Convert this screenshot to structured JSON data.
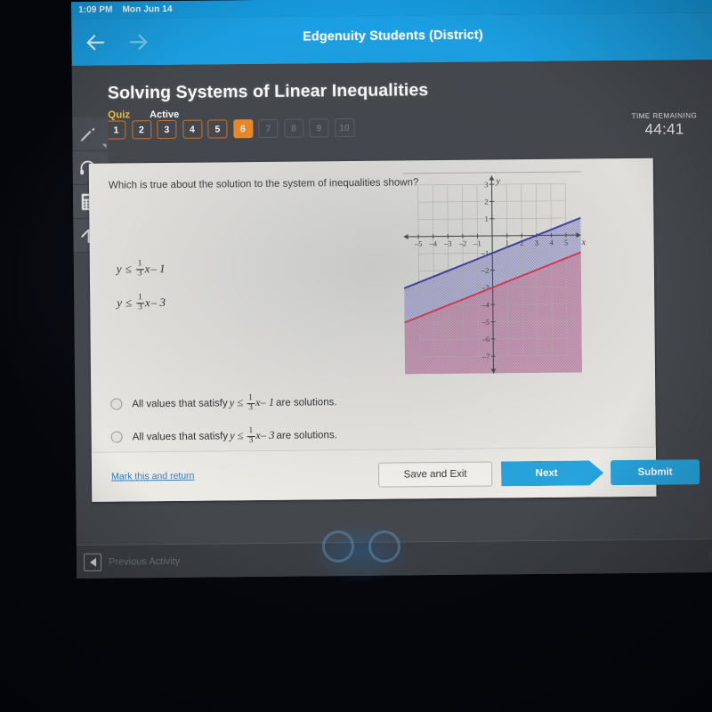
{
  "statusbar": {
    "time": "1:09 PM",
    "date": "Mon Jun 14"
  },
  "appbar": {
    "title": "Edgenuity Students (District)",
    "back_icon": "arrow-back-icon",
    "forward_icon": "arrow-forward-icon"
  },
  "lesson": {
    "title": "Solving Systems of Linear Inequalities",
    "type_label": "Quiz",
    "status_label": "Active"
  },
  "pager": {
    "items": [
      {
        "label": "1",
        "state": "done"
      },
      {
        "label": "2",
        "state": "done"
      },
      {
        "label": "3",
        "state": "done"
      },
      {
        "label": "4",
        "state": "done"
      },
      {
        "label": "5",
        "state": "done"
      },
      {
        "label": "6",
        "state": "current"
      },
      {
        "label": "7",
        "state": "locked"
      },
      {
        "label": "8",
        "state": "locked"
      },
      {
        "label": "9",
        "state": "locked"
      },
      {
        "label": "10",
        "state": "locked"
      }
    ]
  },
  "timer": {
    "label": "TIME REMAINING",
    "value": "44:41"
  },
  "toolrail": {
    "items": [
      {
        "name": "pencil-tool",
        "icon": "pencil-icon"
      },
      {
        "name": "audio-tool",
        "icon": "headphones-icon"
      },
      {
        "name": "calculator-tool",
        "icon": "calculator-icon"
      },
      {
        "name": "collapse-tool",
        "icon": "arrow-up-icon"
      }
    ]
  },
  "question": {
    "prompt": "Which is true about the solution to the system of inequalities shown?",
    "inequalities": [
      {
        "lhs": "y",
        "op": "≤",
        "num": "1",
        "den": "3",
        "var": "x",
        "tail": "– 1"
      },
      {
        "lhs": "y",
        "op": "≤",
        "num": "1",
        "den": "3",
        "var": "x",
        "tail": "– 3"
      }
    ],
    "options": [
      {
        "selected": false,
        "prefix": "All values that satisfy",
        "lhs": "y",
        "op": "≤",
        "num": "1",
        "den": "3",
        "var": "x",
        "tail": "– 1",
        "suffix": "are solutions."
      },
      {
        "selected": false,
        "prefix": "All values that satisfy",
        "lhs": "y",
        "op": "≤",
        "num": "1",
        "den": "3",
        "var": "x",
        "tail": "– 3",
        "suffix": "are solutions."
      }
    ]
  },
  "chart_data": {
    "type": "line",
    "title": "",
    "xlabel": "x",
    "ylabel": "y",
    "xlim": [
      -6,
      6
    ],
    "ylim": [
      -8,
      3.5
    ],
    "xticks": [
      -5,
      -4,
      -3,
      -2,
      -1,
      1,
      2,
      3,
      4,
      5
    ],
    "xticklabels": [
      "-5",
      "-4",
      "-3",
      "-2",
      "-1",
      "1",
      "2",
      "3",
      "4",
      "5"
    ],
    "yticks": [
      3,
      2,
      1,
      -1,
      -2,
      -3,
      -4,
      -5,
      -6,
      -7
    ],
    "yticklabels": [
      "3",
      "2",
      "1",
      "-1",
      "-2",
      "-3",
      "-4",
      "-5",
      "-6",
      "-7"
    ],
    "grid": true,
    "legend": "none",
    "series": [
      {
        "name": "y = (1/3)x - 1",
        "type": "line",
        "slope": 0.3333,
        "intercept": -1,
        "color": "#3f3fa8",
        "linestyle": "solid",
        "shade": "below",
        "shade_color": "#8f8fd0",
        "shade_opacity": 0.45
      },
      {
        "name": "y = (1/3)x - 3",
        "type": "line",
        "slope": 0.3333,
        "intercept": -3,
        "color": "#e03a52",
        "linestyle": "solid",
        "shade": "below",
        "shade_color": "#cf7f9b",
        "shade_opacity": 0.5
      }
    ]
  },
  "footer": {
    "mark_link": "Mark this and return",
    "save_exit": "Save and Exit",
    "next": "Next",
    "submit": "Submit"
  },
  "activitybar": {
    "prev_label": "Previous Activity",
    "next_label": "N",
    "prev_icon": "triangle-left-icon"
  }
}
